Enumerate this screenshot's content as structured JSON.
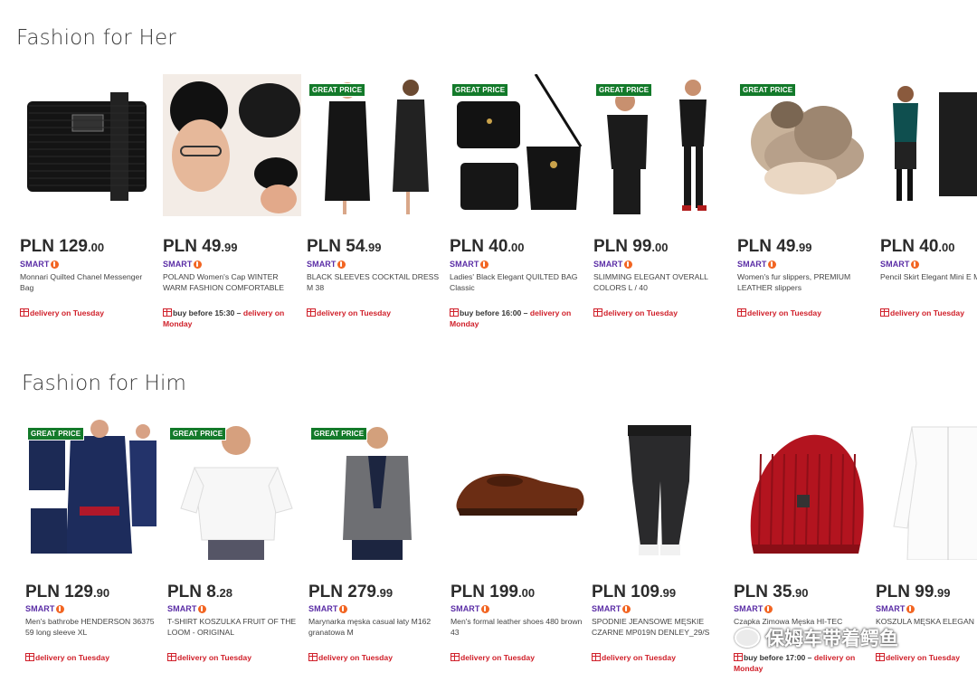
{
  "sections": {
    "her": {
      "title": "Fashion for Her",
      "products": [
        {
          "badge": "",
          "price_cur": "PLN ",
          "price_int": "129",
          "price_frac": ".00",
          "smart": "SMART",
          "name": "Monnari Quilted Chanel Messenger Bag",
          "delivery_pre": "",
          "delivery": "delivery on Tuesday"
        },
        {
          "badge": "",
          "price_cur": "PLN ",
          "price_int": "49",
          "price_frac": ".99",
          "smart": "SMART",
          "name": "POLAND Women's Cap WINTER WARM FASHION COMFORTABLE",
          "delivery_pre": "buy before 15:30 – ",
          "delivery": "delivery on Monday"
        },
        {
          "badge": "GREAT PRICE",
          "price_cur": "PLN ",
          "price_int": "54",
          "price_frac": ".99",
          "smart": "SMART",
          "name": "BLACK SLEEVES COCKTAIL DRESS M 38",
          "delivery_pre": "",
          "delivery": "delivery on Tuesday"
        },
        {
          "badge": "GREAT PRICE",
          "price_cur": "PLN ",
          "price_int": "40",
          "price_frac": ".00",
          "smart": "SMART",
          "name": "Ladies' Black Elegant QUILTED BAG Classic",
          "delivery_pre": "buy before 16:00 – ",
          "delivery": "delivery on Monday"
        },
        {
          "badge": "GREAT PRICE",
          "price_cur": "PLN ",
          "price_int": "99",
          "price_frac": ".00",
          "smart": "SMART",
          "name": "SLIMMING ELEGANT OVERALL COLORS L / 40",
          "delivery_pre": "",
          "delivery": "delivery on Tuesday"
        },
        {
          "badge": "GREAT PRICE",
          "price_cur": "PLN ",
          "price_int": "49",
          "price_frac": ".99",
          "smart": "SMART",
          "name": "Women's fur slippers, PREMIUM LEATHER slippers",
          "delivery_pre": "",
          "delivery": "delivery on Tuesday"
        },
        {
          "badge": "",
          "price_cur": "PLN ",
          "price_int": "40",
          "price_frac": ".00",
          "smart": "SMART",
          "name": "Pencil Skirt Elegant Mini E MORAJ S",
          "delivery_pre": "",
          "delivery": "delivery on Tuesday"
        }
      ]
    },
    "him": {
      "title": "Fashion for Him",
      "products": [
        {
          "badge": "GREAT PRICE",
          "price_cur": "PLN ",
          "price_int": "129",
          "price_frac": ".90",
          "smart": "SMART",
          "name": "Men's bathrobe HENDERSON 36375 59 long sleeve XL",
          "delivery_pre": "",
          "delivery": "delivery on Tuesday"
        },
        {
          "badge": "GREAT PRICE",
          "price_cur": "PLN ",
          "price_int": "8",
          "price_frac": ".28",
          "smart": "SMART",
          "name": "T-SHIRT KOSZULKA FRUIT OF THE LOOM - ORIGINAL",
          "delivery_pre": "",
          "delivery": "delivery on Tuesday"
        },
        {
          "badge": "GREAT PRICE",
          "price_cur": "PLN ",
          "price_int": "279",
          "price_frac": ".99",
          "smart": "SMART",
          "name": "Marynarka męska casual łaty M162 granatowa M",
          "delivery_pre": "",
          "delivery": "delivery on Tuesday"
        },
        {
          "badge": "",
          "price_cur": "PLN ",
          "price_int": "199",
          "price_frac": ".00",
          "smart": "SMART",
          "name": "Men's formal leather shoes 480 brown 43",
          "delivery_pre": "",
          "delivery": "delivery on Tuesday"
        },
        {
          "badge": "",
          "price_cur": "PLN ",
          "price_int": "109",
          "price_frac": ".99",
          "smart": "SMART",
          "name": "SPODNIE JEANSOWE MĘSKIE CZARNE MP019N DENLEY_29/S",
          "delivery_pre": "",
          "delivery": "delivery on Tuesday"
        },
        {
          "badge": "",
          "price_cur": "PLN ",
          "price_int": "35",
          "price_frac": ".90",
          "smart": "SMART",
          "name": "Czapka Zimowa Męska HI-TEC",
          "delivery_pre": "buy before 17:00 – ",
          "delivery": "delivery on Monday"
        },
        {
          "badge": "",
          "price_cur": "PLN ",
          "price_int": "99",
          "price_frac": ".99",
          "smart": "SMART",
          "name": "KOSZULA MĘSKA ELEGAN",
          "delivery_pre": "",
          "delivery": "delivery on Tuesday"
        }
      ]
    }
  },
  "watermark": "保姆车带着鳄鱼",
  "icons": {
    "smart": "smart-bolt-icon",
    "delivery": "gift-icon",
    "watermark": "wechat-icon"
  },
  "colors": {
    "badge_green": "#137a2a",
    "smart_purple": "#5b2ea6",
    "delivery_red": "#d0202a",
    "smart_orange": "#f26522"
  }
}
